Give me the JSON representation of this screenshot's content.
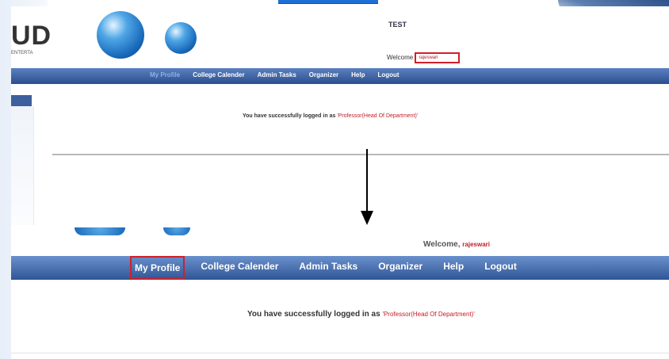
{
  "site": {
    "logo_text": "UD",
    "logo_sub": "ENTERTA",
    "title": "TEST"
  },
  "top": {
    "welcome": "Welcome",
    "username": "rajeswari",
    "nav": [
      "My Profile",
      "College Calender",
      "Admin Tasks",
      "Organizer",
      "Help",
      "Logout"
    ],
    "login_message": "You have successfully logged in as",
    "role": "'Professor(Head Of Department)'"
  },
  "bottom": {
    "welcome": "Welcome,",
    "username": "rajeswari",
    "nav": [
      "My Profile",
      "College Calender",
      "Admin Tasks",
      "Organizer",
      "Help",
      "Logout"
    ],
    "login_message": "You have successfully logged in as",
    "role": "'Professor(Head Of Department)'"
  },
  "colors": {
    "nav_blue": "#2c4e8e",
    "highlight_red": "#d0202a",
    "role_red": "#c21d24"
  },
  "icons": [
    "sphere-logo-icon",
    "down-arrow-icon"
  ]
}
